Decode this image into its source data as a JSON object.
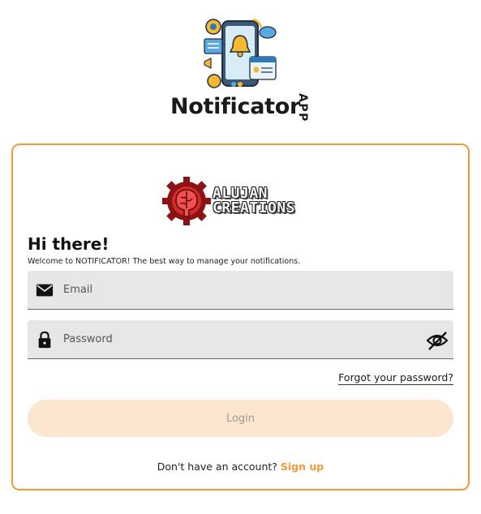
{
  "app": {
    "name": "Notificator",
    "tag": "APP",
    "logo_icon": "notification-phone-illustration"
  },
  "brand": {
    "line1": "ALUJAN",
    "line2": "CREATIONS",
    "logo_icon": "gear-brain-logo"
  },
  "login": {
    "greeting": "Hi there!",
    "subtitle": "Welcome to NOTIFICATOR! The best way to manage your notifications.",
    "email_placeholder": "Email",
    "password_placeholder": "Password",
    "forgot_label": "Forgot your password?",
    "login_label": "Login",
    "no_account_text": "Don't have an account?",
    "signup_label": "Sign up"
  },
  "colors": {
    "accent": "#f29a38",
    "button_bg": "#fde6cf",
    "field_bg": "#e6e6e6"
  }
}
